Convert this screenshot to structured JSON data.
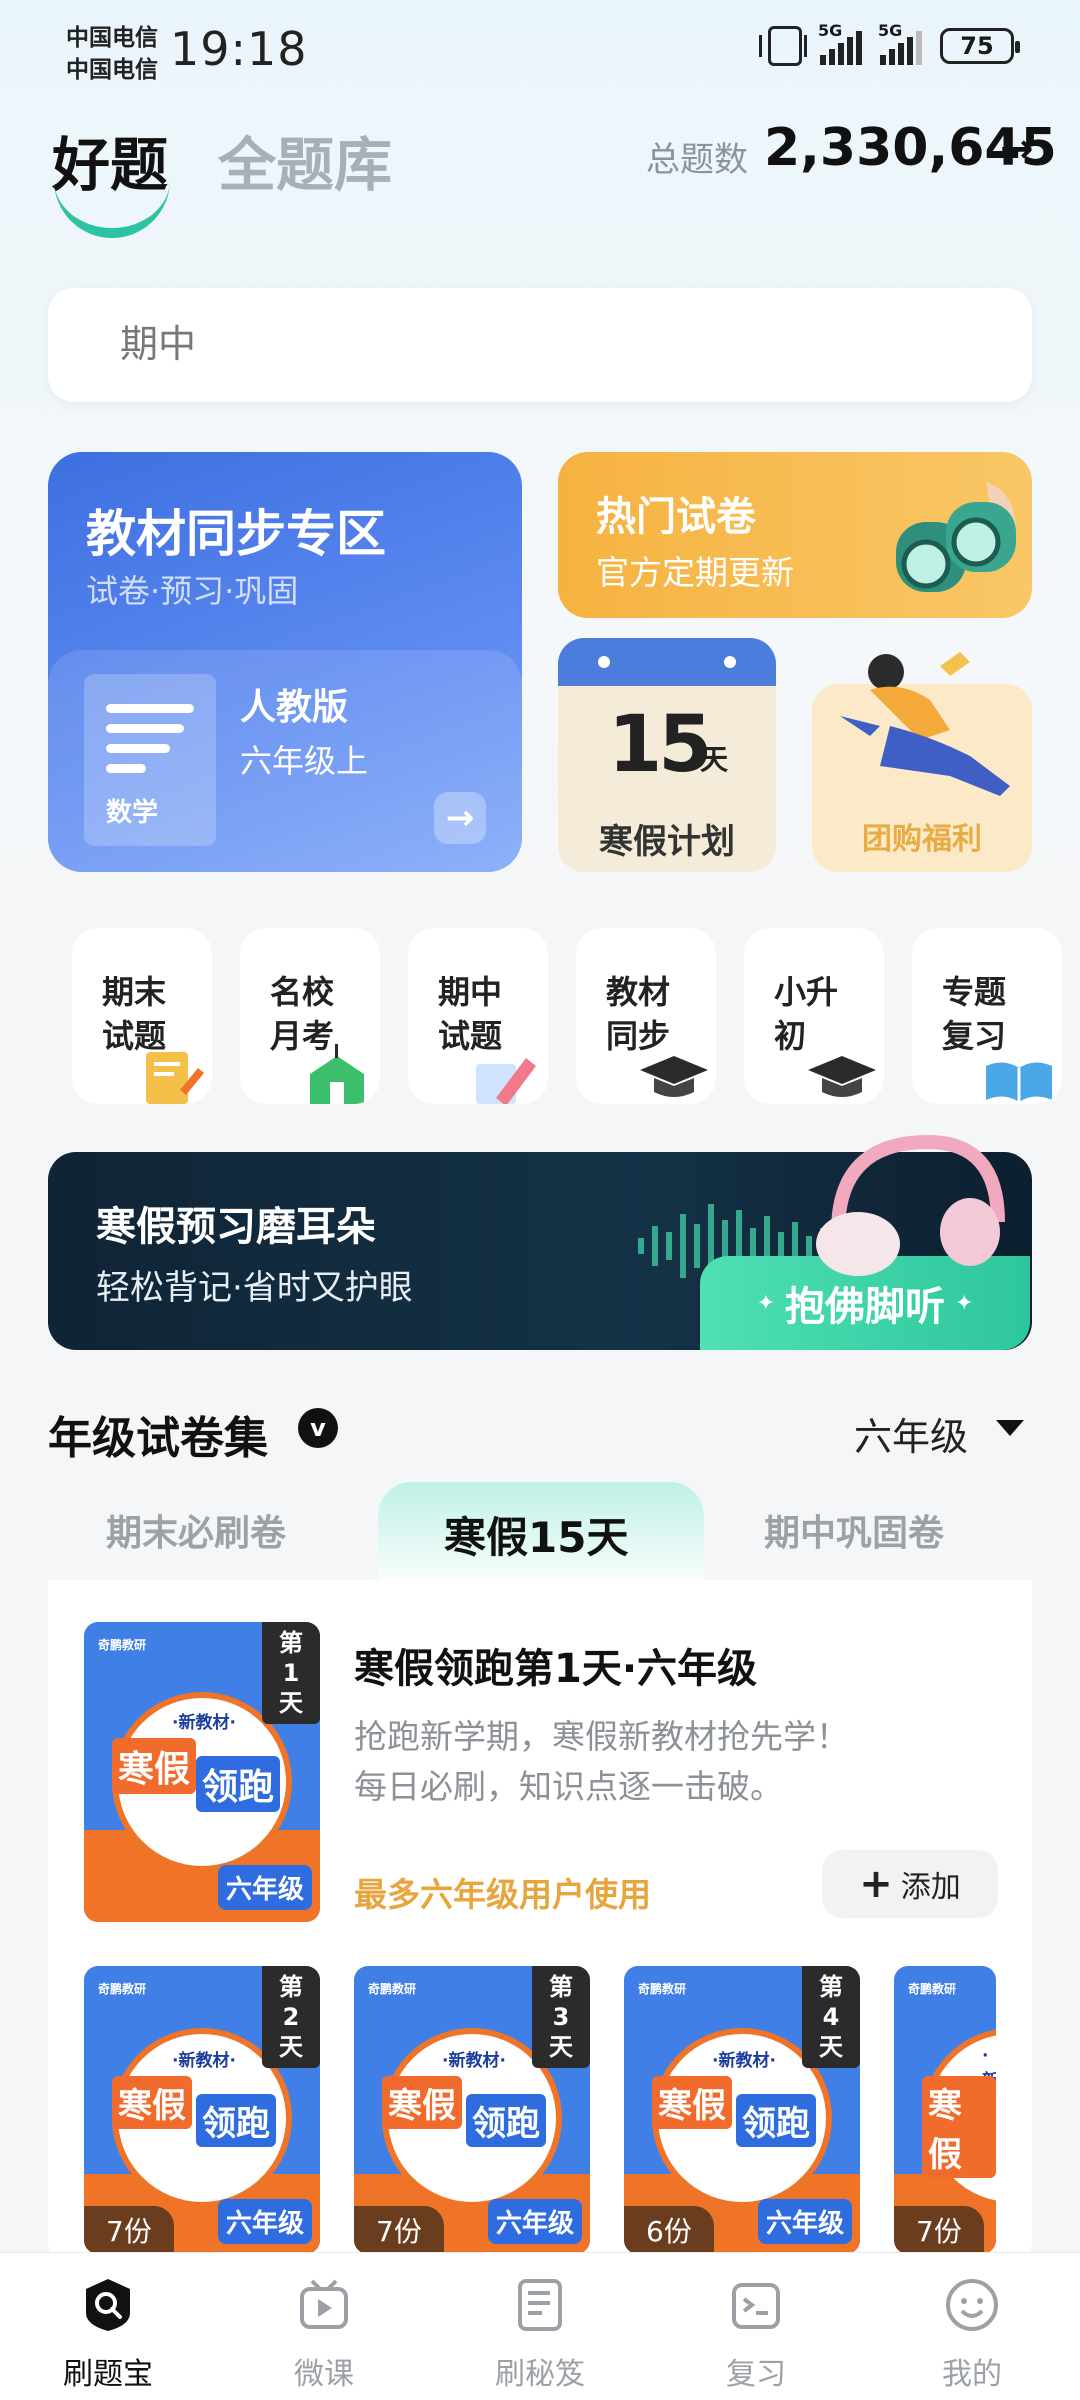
{
  "status_bar": {
    "carrier_1": "中国电信",
    "carrier_2": "中国电信",
    "time": "19:18",
    "network_1": "5G",
    "network_2": "5G",
    "battery": "75"
  },
  "header": {
    "active_tab": "好题",
    "other_tab": "全题库",
    "total_label": "总题数",
    "total_count": "2,330,645",
    "total_arrow": "→"
  },
  "search": {
    "placeholder": "期中"
  },
  "textbook_card": {
    "title": "教材同步专区",
    "subtitle": "试卷·预习·巩固",
    "book_label": "数学",
    "edition": "人教版",
    "grade": "六年级上",
    "go_icon": "→"
  },
  "hot_papers": {
    "title": "热门试卷",
    "subtitle": "官方定期更新"
  },
  "winter_plan": {
    "number": "15",
    "unit": "天",
    "label": "寒假计划"
  },
  "group_buy": {
    "label": "团购福利"
  },
  "shortcuts": [
    {
      "line1": "期末",
      "line2": "试题",
      "icon": "paper-pencil-icon",
      "color": "#f5c04a"
    },
    {
      "line1": "名校",
      "line2": "月考",
      "icon": "school-icon",
      "color": "#3cbf6d"
    },
    {
      "line1": "期中",
      "line2": "试题",
      "icon": "pencil-icon",
      "color": "#f07a8a"
    },
    {
      "line1": "教材",
      "line2": "同步",
      "icon": "graduation-cap-icon",
      "color": "#2b2b2b"
    },
    {
      "line1": "小升",
      "line2": "初",
      "icon": "graduation-cap-icon",
      "color": "#2b2b2b"
    },
    {
      "line1": "专题",
      "line2": "复习",
      "icon": "book-icon",
      "color": "#4aa8e8"
    }
  ],
  "audio_banner": {
    "title": "寒假预习磨耳朵",
    "subtitle": "轻松背记·省时又护眼",
    "button": "抱佛脚听",
    "sparkle": "✦"
  },
  "grade_collection": {
    "title": "年级试卷集",
    "badge": "v",
    "grade_select": "六年级",
    "tabs": [
      "期末必刷卷",
      "寒假15天",
      "期中巩固卷"
    ],
    "active_tab_index": 1
  },
  "featured": {
    "title": "寒假领跑第1天·六年级",
    "desc_1": "抢跑新学期，寒假新教材抢先学！",
    "desc_2": "每日必刷，知识点逐一击破。",
    "hint": "最多六年级用户使用",
    "add_icon": "+",
    "add_label": "添加",
    "cover": {
      "brand": "奇鹏教研",
      "new": "·新教材·",
      "word_1": "寒假",
      "word_2": "领跑",
      "day_1": "第",
      "day_2": "1",
      "day_3": "天",
      "grade": "六年级"
    }
  },
  "day_cards": [
    {
      "brand": "奇鹏教研",
      "new": "·新教材·",
      "word_1": "寒假",
      "word_2": "领跑",
      "day": "2",
      "count": "7份",
      "grade": "六年级"
    },
    {
      "brand": "奇鹏教研",
      "new": "·新教材·",
      "word_1": "寒假",
      "word_2": "领跑",
      "day": "3",
      "count": "7份",
      "grade": "六年级"
    },
    {
      "brand": "奇鹏教研",
      "new": "·新教材·",
      "word_1": "寒假",
      "word_2": "领跑",
      "day": "4",
      "count": "6份",
      "grade": "六年级"
    },
    {
      "brand": "奇鹏教研",
      "new": "·新",
      "word_1": "寒假",
      "word_2": "",
      "day": "",
      "count": "7份",
      "grade": ""
    }
  ],
  "day_tag": {
    "top": "第",
    "bottom": "天"
  },
  "bottom_nav": [
    {
      "label": "刷题宝",
      "icon": "search-icon",
      "active": true
    },
    {
      "label": "微课",
      "icon": "video-icon",
      "active": false
    },
    {
      "label": "刷秘笈",
      "icon": "notebook-icon",
      "active": false
    },
    {
      "label": "复习",
      "icon": "review-icon",
      "active": false
    },
    {
      "label": "我的",
      "icon": "smiley-icon",
      "active": false
    }
  ],
  "colors": {
    "accent": "#2cc3a2",
    "blue": "#3d6fe0",
    "orange": "#f6b240",
    "hint": "#e9a53d"
  }
}
